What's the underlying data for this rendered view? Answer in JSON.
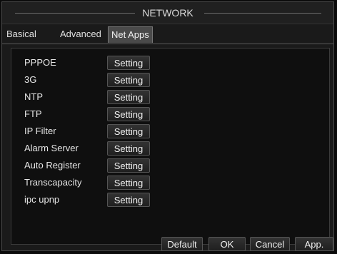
{
  "window": {
    "title": "NETWORK"
  },
  "tabs": [
    {
      "label": "Basical"
    },
    {
      "label": "Advanced"
    },
    {
      "label": "Net Apps",
      "active": true
    }
  ],
  "items": [
    {
      "label": "PPPOE",
      "button": "Setting"
    },
    {
      "label": "3G",
      "button": "Setting"
    },
    {
      "label": "NTP",
      "button": "Setting"
    },
    {
      "label": "FTP",
      "button": "Setting"
    },
    {
      "label": "IP Filter",
      "button": "Setting"
    },
    {
      "label": "Alarm Server",
      "button": "Setting"
    },
    {
      "label": "Auto Register",
      "button": "Setting"
    },
    {
      "label": "Transcapacity",
      "button": "Setting"
    },
    {
      "label": "ipc upnp",
      "button": "Setting"
    }
  ],
  "footer": {
    "default_label": "Default",
    "ok_label": "OK",
    "cancel_label": "Cancel",
    "apply_label": "App."
  }
}
